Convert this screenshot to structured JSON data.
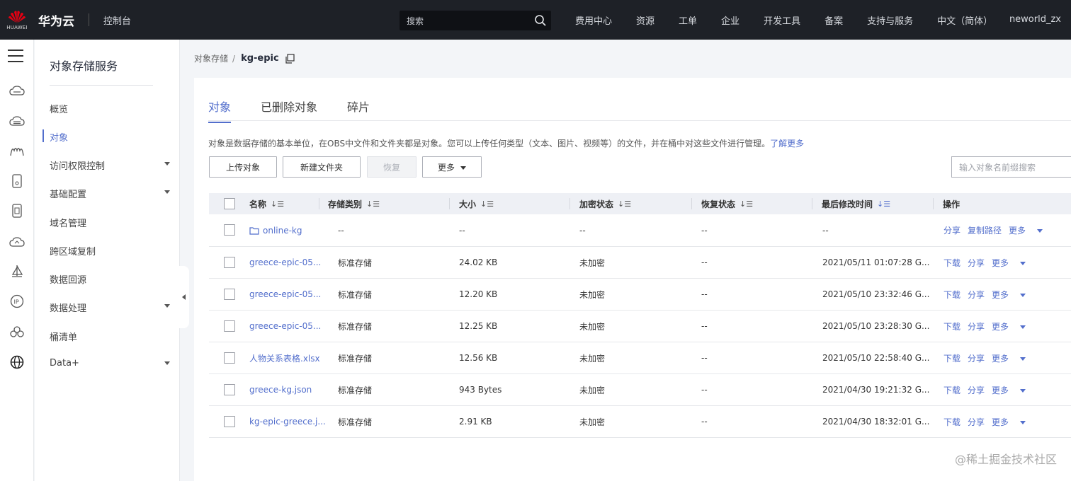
{
  "header": {
    "logo_sub": "HUAWEI",
    "brand": "华为云",
    "console": "控制台",
    "search_placeholder": "搜索",
    "nav": [
      "费用中心",
      "资源",
      "工单",
      "企业",
      "开发工具",
      "备案",
      "支持与服务",
      "中文（简体）"
    ],
    "user": "neworld_zx",
    "brand_color": "#c7000b"
  },
  "sidebar": {
    "title": "对象存储服务",
    "items": [
      {
        "label": "概览",
        "has_caret": false
      },
      {
        "label": "对象",
        "has_caret": false,
        "active": true
      },
      {
        "label": "访问权限控制",
        "has_caret": true
      },
      {
        "label": "基础配置",
        "has_caret": true
      },
      {
        "label": "域名管理",
        "has_caret": false
      },
      {
        "label": "跨区域复制",
        "has_caret": false
      },
      {
        "label": "数据回源",
        "has_caret": false
      },
      {
        "label": "数据处理",
        "has_caret": true
      },
      {
        "label": "桶清单",
        "has_caret": false
      },
      {
        "label": "Data+",
        "has_caret": true
      }
    ]
  },
  "breadcrumb": {
    "root": "对象存储",
    "sep": "/",
    "current": "kg-epic"
  },
  "tabs": [
    {
      "label": "对象",
      "active": true
    },
    {
      "label": "已删除对象",
      "active": false
    },
    {
      "label": "碎片",
      "active": false
    }
  ],
  "description": {
    "text": "对象是数据存储的基本单位，在OBS中文件和文件夹都是对象。您可以上传任何类型（文本、图片、视频等）的文件，并在桶中对这些文件进行管理。",
    "link": "了解更多"
  },
  "toolbar": {
    "upload": "上传对象",
    "new_folder": "新建文件夹",
    "restore": "恢复",
    "more": "更多",
    "search_placeholder": "输入对象名前缀搜索"
  },
  "table": {
    "headers": [
      "名称",
      "存储类别",
      "大小",
      "加密状态",
      "恢复状态",
      "最后修改时间",
      "操作"
    ],
    "rows": [
      {
        "name": "online-kg",
        "folder": true,
        "storage": "--",
        "size": "--",
        "encrypt": "--",
        "restore": "--",
        "modified": "--",
        "ops": [
          "分享",
          "复制路径"
        ],
        "more": "更多"
      },
      {
        "name": "greece-epic-05...",
        "folder": false,
        "storage": "标准存储",
        "size": "24.02 KB",
        "encrypt": "未加密",
        "restore": "--",
        "modified": "2021/05/11 01:07:28 G...",
        "ops": [
          "下载",
          "分享"
        ],
        "more": "更多"
      },
      {
        "name": "greece-epic-05...",
        "folder": false,
        "storage": "标准存储",
        "size": "12.20 KB",
        "encrypt": "未加密",
        "restore": "--",
        "modified": "2021/05/10 23:32:46 G...",
        "ops": [
          "下载",
          "分享"
        ],
        "more": "更多"
      },
      {
        "name": "greece-epic-05...",
        "folder": false,
        "storage": "标准存储",
        "size": "12.25 KB",
        "encrypt": "未加密",
        "restore": "--",
        "modified": "2021/05/10 23:28:30 G...",
        "ops": [
          "下载",
          "分享"
        ],
        "more": "更多"
      },
      {
        "name": "人物关系表格.xlsx",
        "folder": false,
        "storage": "标准存储",
        "size": "12.56 KB",
        "encrypt": "未加密",
        "restore": "--",
        "modified": "2021/05/10 22:58:40 G...",
        "ops": [
          "下载",
          "分享"
        ],
        "more": "更多"
      },
      {
        "name": "greece-kg.json",
        "folder": false,
        "storage": "标准存储",
        "size": "943 Bytes",
        "encrypt": "未加密",
        "restore": "--",
        "modified": "2021/04/30 19:21:32 G...",
        "ops": [
          "下载",
          "分享"
        ],
        "more": "更多"
      },
      {
        "name": "kg-epic-greece.j...",
        "folder": false,
        "storage": "标准存储",
        "size": "2.91 KB",
        "encrypt": "未加密",
        "restore": "--",
        "modified": "2021/04/30 18:32:01 G...",
        "ops": [
          "下载",
          "分享"
        ],
        "more": "更多"
      }
    ]
  },
  "watermark": "@稀土掘金技术社区",
  "accent_color": "#526ecc"
}
